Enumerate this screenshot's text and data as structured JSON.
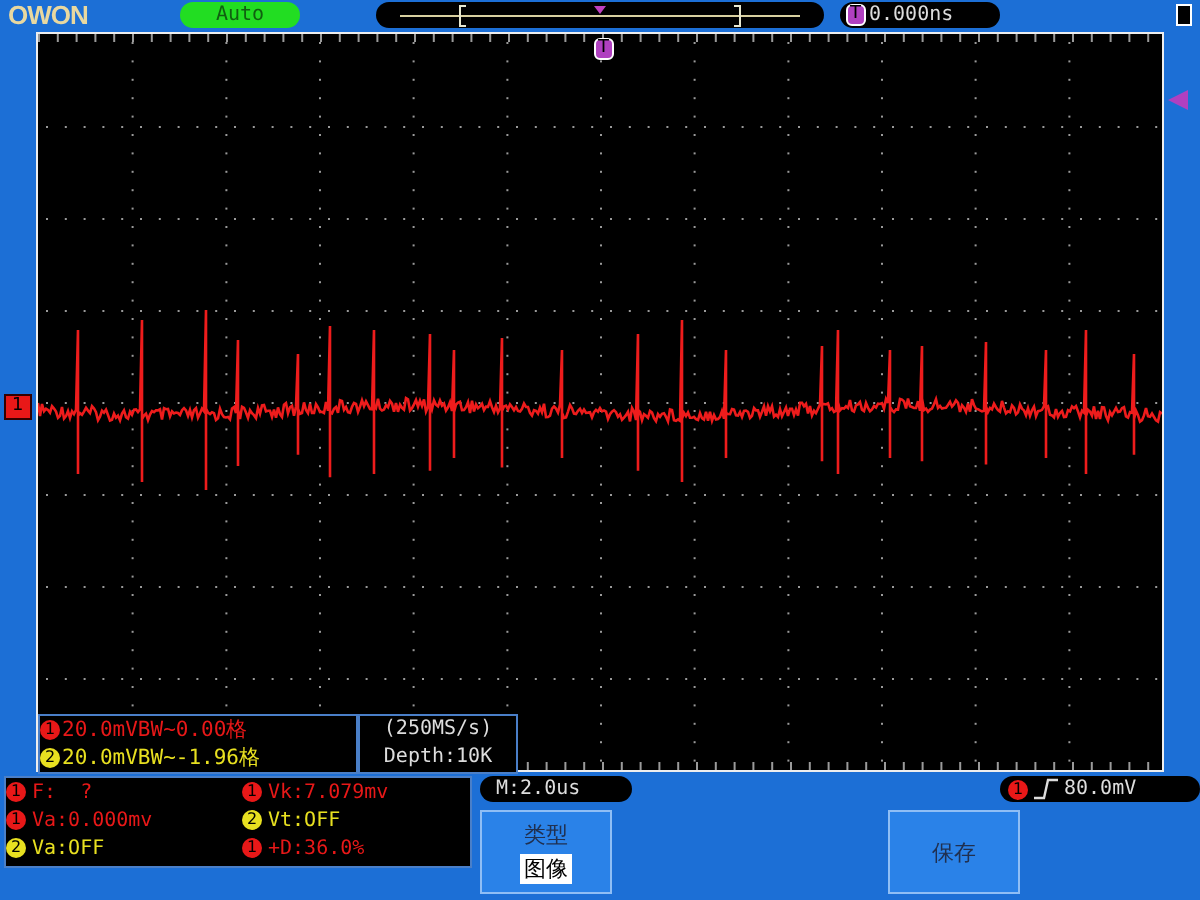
{
  "header": {
    "logo": "OWON",
    "trigger_mode": "Auto",
    "trigger_marker": "T",
    "trigger_position": "0.000ns"
  },
  "screen": {
    "trigger_marker": "T",
    "channel_marker": "1"
  },
  "channels": [
    {
      "marker": "1",
      "color": "#e81818",
      "setting": "20.0mVBW~0.00格"
    },
    {
      "marker": "2",
      "color": "#e8e020",
      "setting": "20.0mVBW~-1.96格"
    }
  ],
  "acquisition": {
    "sample_rate": "(250MS/s)",
    "depth": "Depth:10K"
  },
  "measurements": [
    {
      "marker": "1",
      "color": "#e81818",
      "text": "F:  ?"
    },
    {
      "marker": "1",
      "color": "#e81818",
      "text": "Vk:7.079mv"
    },
    {
      "marker": "1",
      "color": "#e81818",
      "text": "Va:0.000mv"
    },
    {
      "marker": "2",
      "color": "#e8e020",
      "text": "Vt:OFF"
    },
    {
      "marker": "2",
      "color": "#e8e020",
      "text": "Va:OFF"
    },
    {
      "marker": "1",
      "color": "#e81818",
      "text": "+D:36.0%"
    }
  ],
  "timebase": "M:2.0us",
  "trigger": {
    "marker": "1",
    "color": "#e81818",
    "level": "80.0mV"
  },
  "menu": [
    {
      "title": "类型",
      "value": "图像"
    },
    {
      "title": "保存"
    }
  ]
}
